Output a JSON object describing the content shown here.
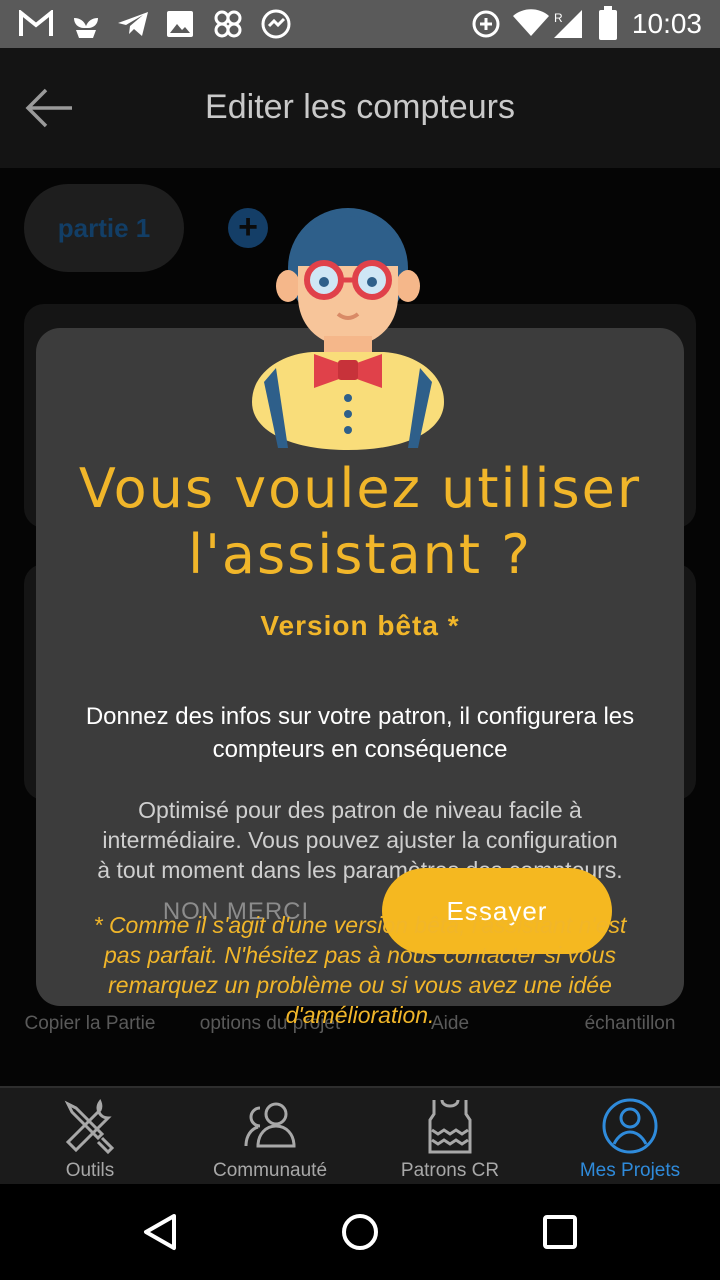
{
  "status_bar": {
    "time": "10:03",
    "left_icons": [
      "gmail-icon",
      "plant-icon",
      "telegram-icon",
      "image-icon",
      "pinwheel-icon",
      "sync-icon"
    ],
    "right_icons": [
      "data-saver-icon",
      "wifi-icon",
      "signal-icon",
      "battery-icon"
    ]
  },
  "app_bar": {
    "title": "Editer les compteurs"
  },
  "content": {
    "part_chip": "partie 1",
    "add_symbol": "+",
    "toolbar_background": [
      "Copier la Partie",
      "options du projet",
      "Aide",
      "échantillon"
    ]
  },
  "dialog": {
    "title": "Vous voulez utiliser l'assistant ?",
    "version": "Version bêta *",
    "description": "Donnez des infos sur votre patron, il configurera les compteurs en conséquence",
    "optimized": "Optimisé pour des patron de niveau facile à intermédiaire. Vous pouvez ajuster la configuration à tout moment dans les paramètres des compteurs.",
    "cancel_label": "NON MERCI",
    "try_label": "Essayer",
    "beta_note": "* Comme il s'agit d'une version bêta, l'assistant n'est pas parfait. N'hésitez pas à nous contacter si vous remarquez un problème ou si vous avez une idée d'amélioration."
  },
  "bottom_nav": {
    "items": [
      {
        "label": "Outils",
        "icon": "tools-icon"
      },
      {
        "label": "Communauté",
        "icon": "community-icon"
      },
      {
        "label": "Patrons CR",
        "icon": "sweater-icon"
      },
      {
        "label": "Mes Projets",
        "icon": "profile-icon",
        "active": true
      }
    ]
  },
  "colors": {
    "accent": "#f1b62a",
    "active_nav": "#2f8bdb",
    "dialog_bg": "#3c3c3c"
  }
}
